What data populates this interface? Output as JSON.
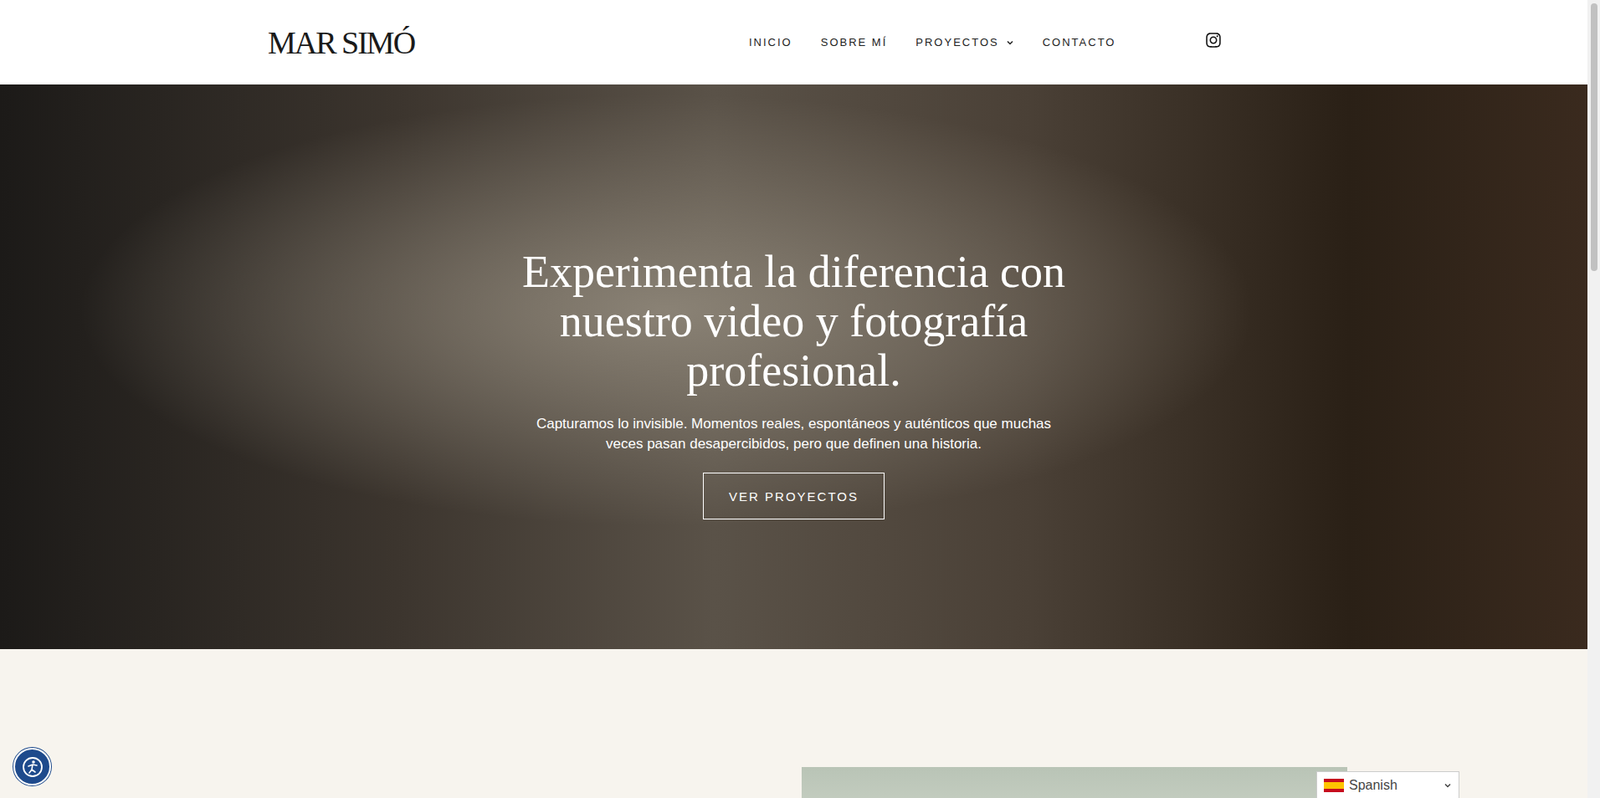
{
  "header": {
    "logo": "MAR SIMÓ",
    "nav": [
      {
        "label": "INICIO",
        "selected": false,
        "has_dropdown": false
      },
      {
        "label": "SOBRE MÍ",
        "selected": false,
        "has_dropdown": false
      },
      {
        "label": "PROYECTOS",
        "selected": false,
        "has_dropdown": true
      },
      {
        "label": "CONTACTO",
        "selected": false,
        "has_dropdown": false
      }
    ]
  },
  "hero": {
    "title_lines": [
      "Experimenta la diferencia con",
      "nuestro video y fotografía",
      "profesional."
    ],
    "subtitle_lines": [
      "Capturamos lo invisible. Momentos reales, espontáneos y auténticos que muchas",
      "veces pasan desapercibidos, pero que definen una historia."
    ],
    "button": "VER PROYECTOS"
  },
  "language_selector": {
    "label": "Spanish",
    "expanded": false
  }
}
